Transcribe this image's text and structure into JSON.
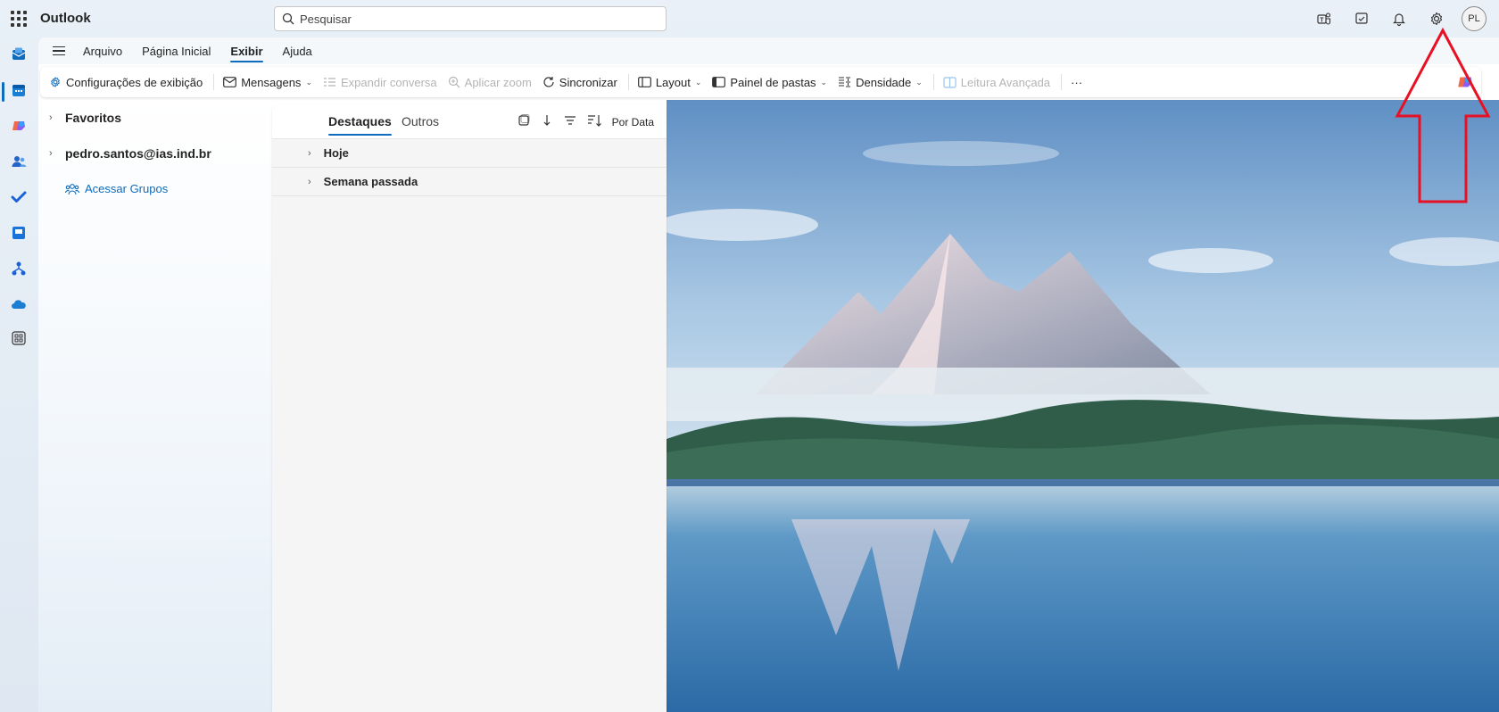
{
  "app": {
    "title": "Outlook"
  },
  "search": {
    "placeholder": "Pesquisar"
  },
  "top_icons": [
    "teams-icon",
    "checklist-icon",
    "bell-icon",
    "gear-icon"
  ],
  "user": {
    "initials": "PL"
  },
  "ribbon": {
    "tabs": [
      {
        "label": "Arquivo",
        "active": false
      },
      {
        "label": "Página Inicial",
        "active": false
      },
      {
        "label": "Exibir",
        "active": true
      },
      {
        "label": "Ajuda",
        "active": false
      }
    ]
  },
  "toolbar": {
    "view_settings": "Configurações de exibição",
    "messages": "Mensagens",
    "expand_conversation": "Expandir conversa",
    "apply_zoom": "Aplicar zoom",
    "sync": "Sincronizar",
    "layout": "Layout",
    "folder_pane": "Painel de pastas",
    "density": "Densidade",
    "immersive_reader": "Leitura Avançada",
    "more": "···"
  },
  "folders": {
    "favorites": "Favoritos",
    "account": "pedro.santos@ias.ind.br",
    "groups_link": "Acessar Grupos"
  },
  "message_list": {
    "tabs": [
      {
        "label": "Destaques",
        "active": true
      },
      {
        "label": "Outros",
        "active": false
      }
    ],
    "sort_label": "Por Data",
    "groups": [
      {
        "label": "Hoje"
      },
      {
        "label": "Semana passada"
      }
    ]
  },
  "colors": {
    "accent": "#0f6cbd",
    "annotation": "#e81123"
  }
}
